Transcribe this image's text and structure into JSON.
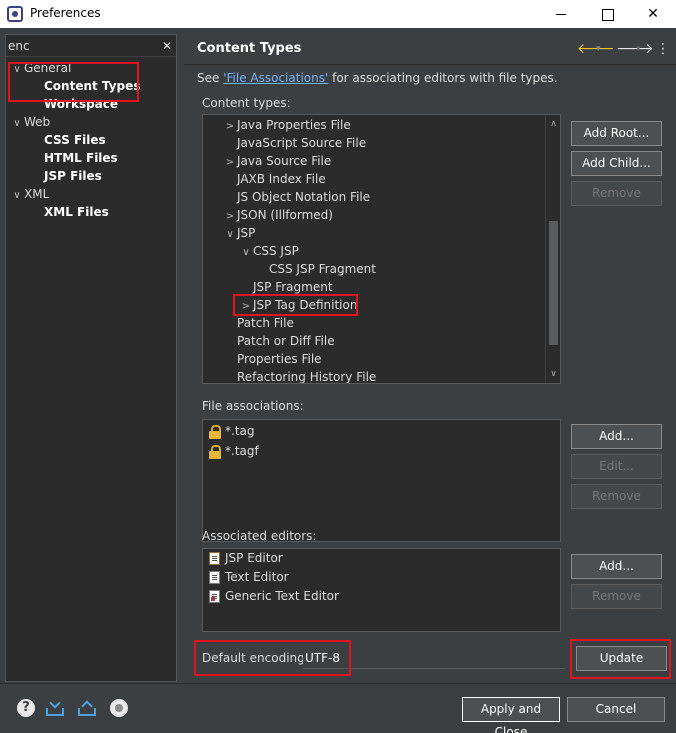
{
  "window": {
    "title": "Preferences",
    "minimize": "",
    "maximize": "",
    "close": "✕"
  },
  "filter": {
    "value": "enc",
    "clear": "✕"
  },
  "tree": [
    {
      "label": "General",
      "twisty": "∨",
      "bold": false,
      "indent": 0
    },
    {
      "label": "Content Types",
      "twisty": "",
      "bold": true,
      "indent": 1
    },
    {
      "label": "Workspace",
      "twisty": "",
      "bold": true,
      "indent": 1
    },
    {
      "label": "Web",
      "twisty": "∨",
      "bold": false,
      "indent": 0
    },
    {
      "label": "CSS Files",
      "twisty": "",
      "bold": true,
      "indent": 1
    },
    {
      "label": "HTML Files",
      "twisty": "",
      "bold": true,
      "indent": 1
    },
    {
      "label": "JSP Files",
      "twisty": "",
      "bold": true,
      "indent": 1
    },
    {
      "label": "XML",
      "twisty": "∨",
      "bold": false,
      "indent": 0
    },
    {
      "label": "XML Files",
      "twisty": "",
      "bold": true,
      "indent": 1
    }
  ],
  "page": {
    "title": "Content Types",
    "nav_back": "🡐",
    "nav_forward": "🡒",
    "menu": "⋮",
    "see_prefix": "See ",
    "see_link": "'File Associations'",
    "see_suffix": " for associating editors with file types.",
    "content_types_label": "Content types:",
    "content_types": [
      {
        "label": "Java Properties File",
        "twisty": ">",
        "level": 0
      },
      {
        "label": "JavaScript Source File",
        "twisty": "",
        "level": 0
      },
      {
        "label": "Java Source File",
        "twisty": ">",
        "level": 0
      },
      {
        "label": "JAXB Index File",
        "twisty": "",
        "level": 0
      },
      {
        "label": "JS Object Notation File",
        "twisty": "",
        "level": 0
      },
      {
        "label": "JSON (Illformed)",
        "twisty": ">",
        "level": 0
      },
      {
        "label": "JSP",
        "twisty": "∨",
        "level": 0
      },
      {
        "label": "CSS JSP",
        "twisty": "∨",
        "level": 1
      },
      {
        "label": "CSS JSP Fragment",
        "twisty": "",
        "level": 2
      },
      {
        "label": "JSP Fragment",
        "twisty": "",
        "level": 1
      },
      {
        "label": "JSP Tag Definition",
        "twisty": ">",
        "level": 1
      },
      {
        "label": "Patch File",
        "twisty": "",
        "level": 0
      },
      {
        "label": "Patch or Diff File",
        "twisty": "",
        "level": 0
      },
      {
        "label": "Properties File",
        "twisty": "",
        "level": 0
      },
      {
        "label": "Refactoring History File",
        "twisty": "",
        "level": 0
      }
    ],
    "add_root": "Add Root...",
    "add_child": "Add Child...",
    "remove": "Remove",
    "file_assoc_label": "File associations:",
    "file_assocs": [
      "*.tag",
      "*.tagf"
    ],
    "add": "Add...",
    "edit": "Edit...",
    "editors_label": "Associated editors:",
    "editors": [
      {
        "label": "JSP Editor",
        "icon": "jsp-editor-icon"
      },
      {
        "label": "Text Editor",
        "icon": "text-editor-icon"
      },
      {
        "label": "Generic Text Editor",
        "icon": "generic-editor-icon"
      }
    ],
    "encoding_label": "Default encoding:",
    "encoding_value": "UTF-8",
    "update": "Update"
  },
  "footer": {
    "help": "?",
    "apply_close": "Apply and Close",
    "cancel": "Cancel"
  },
  "colors": {
    "highlight": "#e0141e",
    "link": "#6fb3ff",
    "background": "#3c3f41"
  }
}
